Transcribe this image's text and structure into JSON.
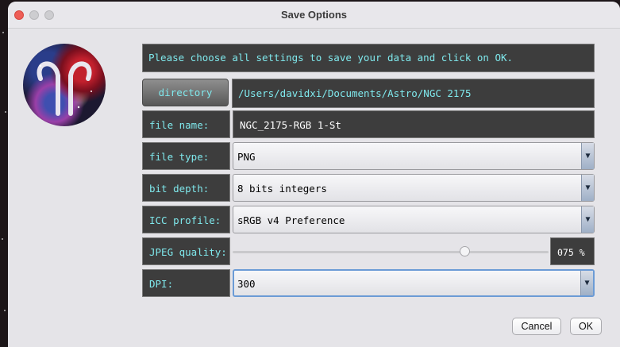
{
  "window": {
    "title": "Save Options"
  },
  "message": "Please choose all settings to save your data and click on OK.",
  "directory": {
    "button_label": "directory",
    "path": "/Users/davidxi/Documents/Astro/NGC 2175"
  },
  "file_name": {
    "label": "file name:",
    "value": "NGC_2175-RGB 1-St"
  },
  "file_type": {
    "label": "file type:",
    "selected": "PNG"
  },
  "bit_depth": {
    "label": "bit depth:",
    "selected": "8 bits integers"
  },
  "icc_profile": {
    "label": "ICC profile:",
    "selected": "sRGB v4 Preference"
  },
  "jpeg_quality": {
    "label": "JPEG quality:",
    "value": 75,
    "display": "075 %"
  },
  "dpi": {
    "label": "DPI:",
    "selected": "300"
  },
  "buttons": {
    "cancel": "Cancel",
    "ok": "OK"
  },
  "icons": {
    "dropdown": "chevron-down-icon",
    "logo": "ram-horns-logo-icon"
  },
  "colors": {
    "label_text": "#7fe8ec",
    "field_bg": "#3d3d3d",
    "close": "#ee5e57"
  }
}
